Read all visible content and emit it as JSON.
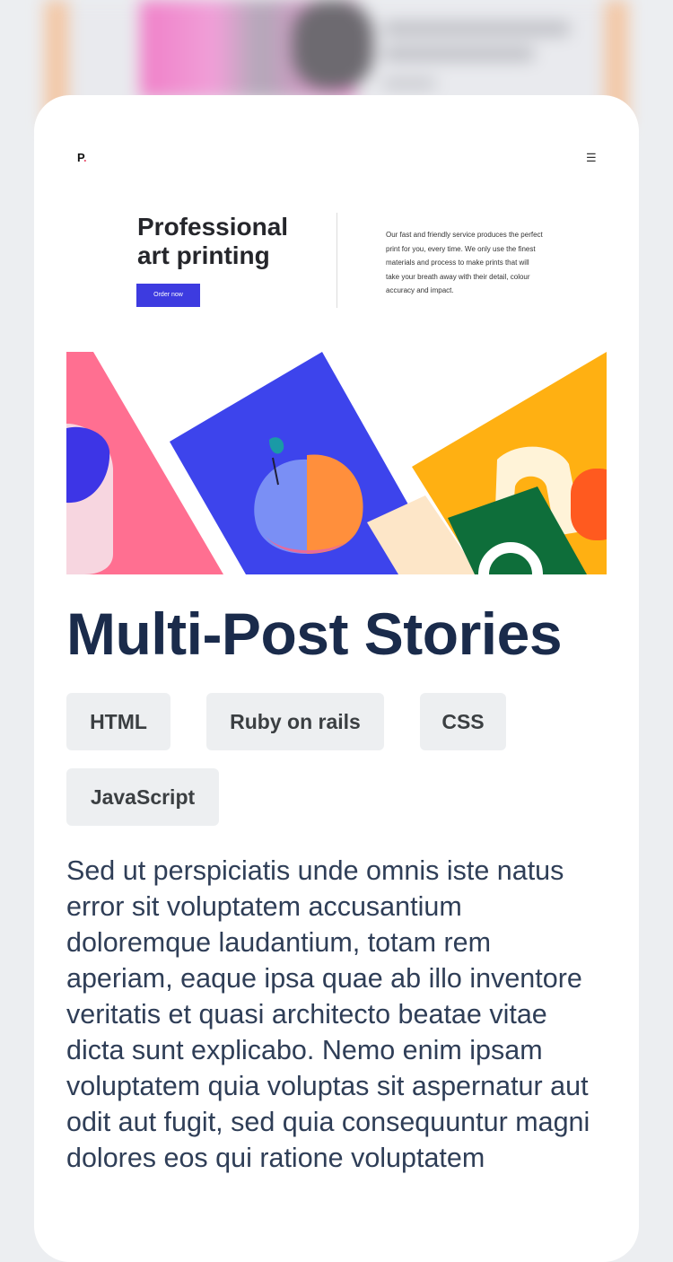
{
  "preview": {
    "logo": "P",
    "logo_dot": ".",
    "menu_icon": "hamburger-menu-icon",
    "headline": "Professional art printing",
    "cta_label": "Order now",
    "description": "Our fast and friendly service produces the perfect print for you, every time. We only use the finest materials and process to make prints that will take your breath away with their detail, colour accuracy and impact."
  },
  "post": {
    "title": "Multi-Post Stories",
    "tags": [
      "HTML",
      "Ruby on rails",
      "CSS",
      "JavaScript"
    ],
    "body": "Sed ut perspiciatis unde omnis iste natus error sit voluptatem accusantium doloremque laudantium, totam rem aperiam, eaque ipsa quae ab illo inventore veritatis et quasi architecto beatae vitae dicta sunt explicabo. Nemo enim ipsam voluptatem quia voluptas sit aspernatur aut odit aut fugit, sed quia consequuntur magni dolores eos qui ratione voluptatem"
  },
  "colors": {
    "page_background": "#eceef1",
    "title": "#1a2b4b",
    "tag_background": "#edeff1",
    "cta": "#3d3be0"
  }
}
